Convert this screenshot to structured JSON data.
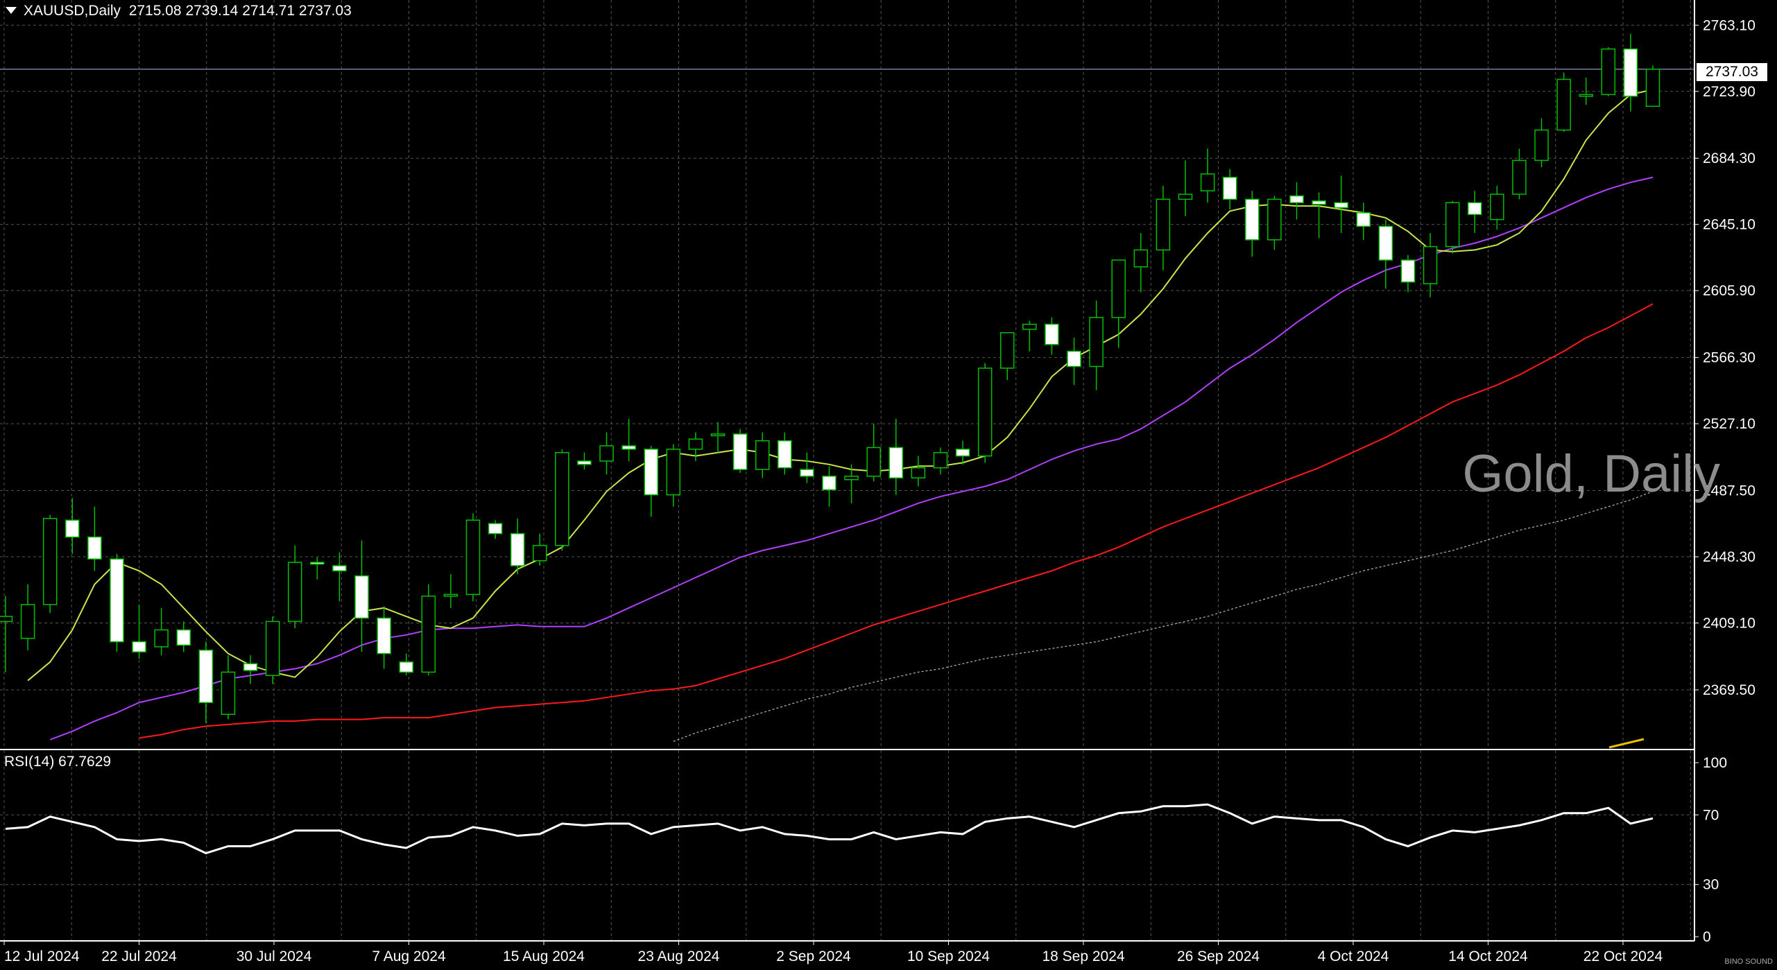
{
  "header": {
    "symbol": "XAUUSD,Daily",
    "ohlc": "2715.08 2739.14 2714.71 2737.03"
  },
  "current_price": "2737.03",
  "watermark": "Gold, Daily",
  "rsi": {
    "label": "RSI(14) 67.7629"
  },
  "logo_text": "BINO SOUND",
  "colors": {
    "background": "#000000",
    "grid": "#555555",
    "bull_candle": "#00c000",
    "bear_candle": "#ffffff",
    "ma_fast": "#c8e64a",
    "ma_mid": "#b040ff",
    "ma_slow": "#ff1a1a",
    "ma_long": "#bbbbbb",
    "rsi_line": "#ffffff",
    "price_line": "#6e7f9a"
  },
  "chart_data": [
    {
      "type": "candlestick",
      "title": "XAUUSD,Daily",
      "ylim": [
        2335,
        2778
      ],
      "y_ticks": [
        "2763.10",
        "2723.90",
        "2684.30",
        "2645.10",
        "2605.90",
        "2566.30",
        "2527.10",
        "2487.50",
        "2448.30",
        "2409.10",
        "2369.50"
      ],
      "x_ticks": [
        "12 Jul 2024",
        "22 Jul 2024",
        "30 Jul 2024",
        "7 Aug 2024",
        "15 Aug 2024",
        "23 Aug 2024",
        "2 Sep 2024",
        "10 Sep 2024",
        "18 Sep 2024",
        "26 Sep 2024",
        "4 Oct 2024",
        "14 Oct 2024",
        "22 Oct 2024"
      ],
      "candles": [
        {
          "o": 2410,
          "h": 2425,
          "l": 2380,
          "c": 2413
        },
        {
          "o": 2400,
          "h": 2432,
          "l": 2393,
          "c": 2420
        },
        {
          "o": 2420,
          "h": 2473,
          "l": 2415,
          "c": 2471
        },
        {
          "o": 2470,
          "h": 2483,
          "l": 2450,
          "c": 2460
        },
        {
          "o": 2460,
          "h": 2478,
          "l": 2440,
          "c": 2447
        },
        {
          "o": 2447,
          "h": 2450,
          "l": 2392,
          "c": 2398
        },
        {
          "o": 2398,
          "h": 2420,
          "l": 2388,
          "c": 2392
        },
        {
          "o": 2395,
          "h": 2418,
          "l": 2390,
          "c": 2405
        },
        {
          "o": 2405,
          "h": 2410,
          "l": 2392,
          "c": 2396
        },
        {
          "o": 2393,
          "h": 2398,
          "l": 2350,
          "c": 2362
        },
        {
          "o": 2355,
          "h": 2390,
          "l": 2352,
          "c": 2380
        },
        {
          "o": 2385,
          "h": 2390,
          "l": 2373,
          "c": 2381
        },
        {
          "o": 2378,
          "h": 2413,
          "l": 2373,
          "c": 2410
        },
        {
          "o": 2410,
          "h": 2455,
          "l": 2406,
          "c": 2445
        },
        {
          "o": 2445,
          "h": 2448,
          "l": 2435,
          "c": 2444
        },
        {
          "o": 2443,
          "h": 2451,
          "l": 2422,
          "c": 2440
        },
        {
          "o": 2437,
          "h": 2458,
          "l": 2392,
          "c": 2412
        },
        {
          "o": 2412,
          "h": 2419,
          "l": 2382,
          "c": 2391
        },
        {
          "o": 2386,
          "h": 2391,
          "l": 2378,
          "c": 2380
        },
        {
          "o": 2380,
          "h": 2432,
          "l": 2378,
          "c": 2425
        },
        {
          "o": 2425,
          "h": 2438,
          "l": 2418,
          "c": 2426
        },
        {
          "o": 2426,
          "h": 2474,
          "l": 2422,
          "c": 2470
        },
        {
          "o": 2468,
          "h": 2470,
          "l": 2459,
          "c": 2462
        },
        {
          "o": 2462,
          "h": 2471,
          "l": 2438,
          "c": 2443
        },
        {
          "o": 2446,
          "h": 2462,
          "l": 2443,
          "c": 2455
        },
        {
          "o": 2455,
          "h": 2512,
          "l": 2452,
          "c": 2510
        },
        {
          "o": 2505,
          "h": 2510,
          "l": 2500,
          "c": 2503
        },
        {
          "o": 2505,
          "h": 2522,
          "l": 2497,
          "c": 2514
        },
        {
          "o": 2514,
          "h": 2530,
          "l": 2505,
          "c": 2512
        },
        {
          "o": 2512,
          "h": 2514,
          "l": 2472,
          "c": 2485
        },
        {
          "o": 2485,
          "h": 2515,
          "l": 2478,
          "c": 2512
        },
        {
          "o": 2512,
          "h": 2522,
          "l": 2505,
          "c": 2518
        },
        {
          "o": 2520,
          "h": 2528,
          "l": 2510,
          "c": 2521
        },
        {
          "o": 2521,
          "h": 2524,
          "l": 2498,
          "c": 2500
        },
        {
          "o": 2500,
          "h": 2522,
          "l": 2495,
          "c": 2517
        },
        {
          "o": 2517,
          "h": 2522,
          "l": 2497,
          "c": 2501
        },
        {
          "o": 2500,
          "h": 2510,
          "l": 2492,
          "c": 2496
        },
        {
          "o": 2496,
          "h": 2502,
          "l": 2478,
          "c": 2488
        },
        {
          "o": 2494,
          "h": 2503,
          "l": 2480,
          "c": 2496
        },
        {
          "o": 2496,
          "h": 2527,
          "l": 2493,
          "c": 2513
        },
        {
          "o": 2513,
          "h": 2530,
          "l": 2485,
          "c": 2495
        },
        {
          "o": 2495,
          "h": 2508,
          "l": 2490,
          "c": 2501
        },
        {
          "o": 2501,
          "h": 2513,
          "l": 2497,
          "c": 2510
        },
        {
          "o": 2512,
          "h": 2517,
          "l": 2503,
          "c": 2508
        },
        {
          "o": 2508,
          "h": 2563,
          "l": 2504,
          "c": 2560
        },
        {
          "o": 2560,
          "h": 2578,
          "l": 2553,
          "c": 2581
        },
        {
          "o": 2583,
          "h": 2588,
          "l": 2570,
          "c": 2586
        },
        {
          "o": 2586,
          "h": 2590,
          "l": 2568,
          "c": 2574
        },
        {
          "o": 2570,
          "h": 2578,
          "l": 2550,
          "c": 2561
        },
        {
          "o": 2561,
          "h": 2600,
          "l": 2547,
          "c": 2590
        },
        {
          "o": 2590,
          "h": 2622,
          "l": 2572,
          "c": 2624
        },
        {
          "o": 2620,
          "h": 2640,
          "l": 2605,
          "c": 2630
        },
        {
          "o": 2630,
          "h": 2668,
          "l": 2618,
          "c": 2660
        },
        {
          "o": 2660,
          "h": 2683,
          "l": 2650,
          "c": 2663
        },
        {
          "o": 2665,
          "h": 2690,
          "l": 2658,
          "c": 2675
        },
        {
          "o": 2673,
          "h": 2678,
          "l": 2654,
          "c": 2660
        },
        {
          "o": 2660,
          "h": 2665,
          "l": 2626,
          "c": 2636
        },
        {
          "o": 2636,
          "h": 2662,
          "l": 2630,
          "c": 2660
        },
        {
          "o": 2662,
          "h": 2670,
          "l": 2648,
          "c": 2658
        },
        {
          "o": 2659,
          "h": 2664,
          "l": 2637,
          "c": 2657
        },
        {
          "o": 2658,
          "h": 2674,
          "l": 2640,
          "c": 2655
        },
        {
          "o": 2652,
          "h": 2658,
          "l": 2636,
          "c": 2644
        },
        {
          "o": 2644,
          "h": 2648,
          "l": 2607,
          "c": 2624
        },
        {
          "o": 2624,
          "h": 2627,
          "l": 2605,
          "c": 2611
        },
        {
          "o": 2610,
          "h": 2640,
          "l": 2602,
          "c": 2632
        },
        {
          "o": 2632,
          "h": 2659,
          "l": 2628,
          "c": 2658
        },
        {
          "o": 2658,
          "h": 2665,
          "l": 2640,
          "c": 2651
        },
        {
          "o": 2648,
          "h": 2668,
          "l": 2642,
          "c": 2663
        },
        {
          "o": 2663,
          "h": 2690,
          "l": 2660,
          "c": 2683
        },
        {
          "o": 2683,
          "h": 2708,
          "l": 2679,
          "c": 2701
        },
        {
          "o": 2701,
          "h": 2735,
          "l": 2700,
          "c": 2731
        },
        {
          "o": 2721,
          "h": 2732,
          "l": 2716,
          "c": 2722
        },
        {
          "o": 2722,
          "h": 2750,
          "l": 2721,
          "c": 2749
        },
        {
          "o": 2749,
          "h": 2758,
          "l": 2712,
          "c": 2721
        },
        {
          "o": 2715.08,
          "h": 2739.14,
          "l": 2714.71,
          "c": 2737.03
        }
      ],
      "ma_fast": [
        2375,
        2386,
        2405,
        2432,
        2445,
        2440,
        2432,
        2418,
        2404,
        2391,
        2384,
        2380,
        2377,
        2389,
        2404,
        2416,
        2418,
        2413,
        2408,
        2406,
        2412,
        2428,
        2441,
        2447,
        2454,
        2470,
        2487,
        2498,
        2506,
        2510,
        2508,
        2510,
        2512,
        2510,
        2506,
        2505,
        2503,
        2500,
        2499,
        2500,
        2502,
        2502,
        2504,
        2508,
        2519,
        2536,
        2555,
        2566,
        2573,
        2580,
        2592,
        2607,
        2625,
        2640,
        2653,
        2656,
        2657,
        2656,
        2656,
        2654,
        2652,
        2649,
        2641,
        2630,
        2629,
        2630,
        2633,
        2640,
        2653,
        2672,
        2695,
        2711,
        2722,
        2725
      ],
      "ma_mid": [
        2340,
        2345,
        2351,
        2356,
        2362,
        2365,
        2368,
        2372,
        2376,
        2378,
        2380,
        2382,
        2385,
        2390,
        2396,
        2400,
        2402,
        2405,
        2406,
        2406,
        2407,
        2408,
        2407,
        2407,
        2407,
        2412,
        2418,
        2424,
        2430,
        2436,
        2442,
        2448,
        2452,
        2455,
        2458,
        2462,
        2466,
        2470,
        2475,
        2480,
        2484,
        2487,
        2490,
        2494,
        2500,
        2506,
        2511,
        2515,
        2518,
        2524,
        2532,
        2540,
        2550,
        2560,
        2568,
        2577,
        2587,
        2596,
        2605,
        2612,
        2618,
        2622,
        2627,
        2631,
        2634,
        2638,
        2643,
        2649,
        2655,
        2661,
        2666,
        2670,
        2673
      ],
      "ma_slow": [
        2341,
        2343,
        2346,
        2348,
        2349,
        2350,
        2351,
        2351,
        2352,
        2352,
        2352,
        2353,
        2353,
        2353,
        2355,
        2357,
        2359,
        2360,
        2361,
        2362,
        2363,
        2365,
        2367,
        2369,
        2370,
        2372,
        2376,
        2380,
        2384,
        2388,
        2393,
        2398,
        2403,
        2408,
        2412,
        2416,
        2420,
        2424,
        2428,
        2432,
        2436,
        2440,
        2445,
        2449,
        2454,
        2460,
        2466,
        2471,
        2476,
        2481,
        2486,
        2491,
        2496,
        2501,
        2507,
        2513,
        2519,
        2526,
        2533,
        2540,
        2545,
        2550,
        2556,
        2563,
        2570,
        2578,
        2584,
        2591,
        2598
      ],
      "ma_long": [
        2339,
        2344,
        2348,
        2352,
        2356,
        2360,
        2364,
        2367,
        2371,
        2374,
        2377,
        2380,
        2382,
        2385,
        2388,
        2390,
        2392,
        2394,
        2396,
        2398,
        2401,
        2404,
        2407,
        2410,
        2413,
        2417,
        2421,
        2425,
        2429,
        2432,
        2436,
        2440,
        2443,
        2446,
        2449,
        2452,
        2456,
        2460,
        2464,
        2467,
        2470,
        2474,
        2478,
        2482,
        2487
      ]
    },
    {
      "type": "line",
      "title": "RSI(14) 67.7629",
      "ylim": [
        0,
        100
      ],
      "y_ticks": [
        "100",
        "70",
        "30",
        "0"
      ],
      "series": [
        {
          "values": [
            62,
            63,
            69,
            66,
            63,
            56,
            55,
            56,
            54,
            48,
            52,
            52,
            56,
            61,
            61,
            61,
            56,
            53,
            51,
            57,
            58,
            63,
            61,
            58,
            59,
            65,
            64,
            65,
            65,
            59,
            63,
            64,
            65,
            61,
            63,
            59,
            58,
            56,
            56,
            60,
            56,
            58,
            60,
            59,
            66,
            68,
            69,
            66,
            63,
            67,
            71,
            72,
            75,
            75,
            76,
            71,
            65,
            69,
            68,
            67,
            67,
            63,
            56,
            52,
            57,
            61,
            60,
            62,
            64,
            67,
            71,
            71,
            74,
            65,
            68
          ]
        }
      ]
    }
  ]
}
